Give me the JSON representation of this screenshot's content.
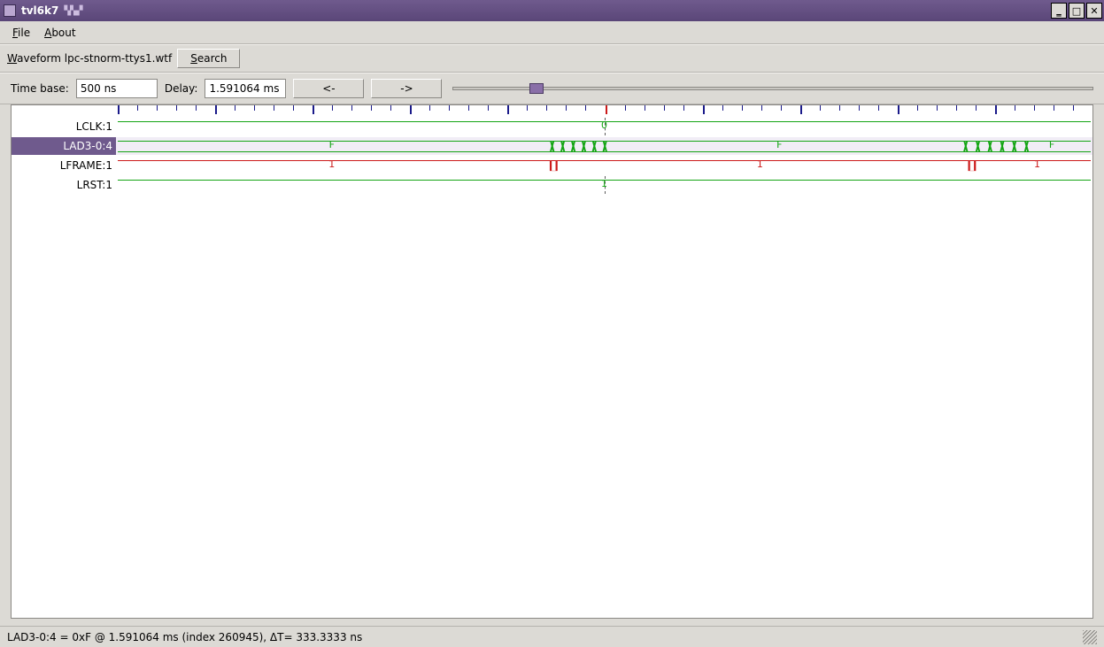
{
  "window": {
    "title": "tvl6k7"
  },
  "menu": {
    "file": "File",
    "about": "About"
  },
  "toolbar": {
    "waveform_label_pre": "W",
    "waveform_label": "aveform lpc-stnorm-ttys1.wtf",
    "search_pre": "S",
    "search": "earch"
  },
  "controls": {
    "timebase_label": "Time base:",
    "timebase_value": "500 ns",
    "delay_label": "Delay:",
    "delay_value": "1.591064 ms",
    "prev": "<-",
    "next": "->",
    "slider_pct": 13
  },
  "signals": [
    {
      "name": "LCLK:1",
      "selected": false,
      "type": "line",
      "color": "green",
      "level": "high",
      "values": [
        {
          "pct": 50,
          "text": "0",
          "color": "green"
        }
      ],
      "cursor_dash": true
    },
    {
      "name": "LAD3-0:4",
      "selected": true,
      "type": "bus",
      "color": "green",
      "values": [
        {
          "pct": 22,
          "text": "F",
          "color": "green"
        },
        {
          "pct": 68,
          "text": "F",
          "color": "green"
        },
        {
          "pct": 96,
          "text": "F",
          "color": "green"
        }
      ],
      "bursts": [
        {
          "start": 44.5,
          "width": 6.5
        },
        {
          "start": 87,
          "width": 7.5
        }
      ]
    },
    {
      "name": "LFRAME:1",
      "selected": false,
      "type": "line",
      "color": "red",
      "level": "high",
      "values": [
        {
          "pct": 22,
          "text": "1",
          "color": "red"
        },
        {
          "pct": 66,
          "text": "1",
          "color": "red"
        },
        {
          "pct": 94.5,
          "text": "1",
          "color": "red"
        }
      ],
      "pulses": [
        44.5,
        87.5
      ]
    },
    {
      "name": "LRST:1",
      "selected": false,
      "type": "line",
      "color": "green",
      "level": "high",
      "values": [
        {
          "pct": 50,
          "text": "1",
          "color": "green"
        }
      ],
      "cursor_dash": true
    }
  ],
  "ruler": {
    "cursor_pct": 50,
    "majors": [
      0,
      10,
      20,
      30,
      40,
      50,
      60,
      70,
      80,
      90,
      100
    ]
  },
  "status": {
    "text": "LAD3-0:4 = 0xF @ 1.591064 ms  (index 260945), ΔT= 333.3333 ns"
  }
}
